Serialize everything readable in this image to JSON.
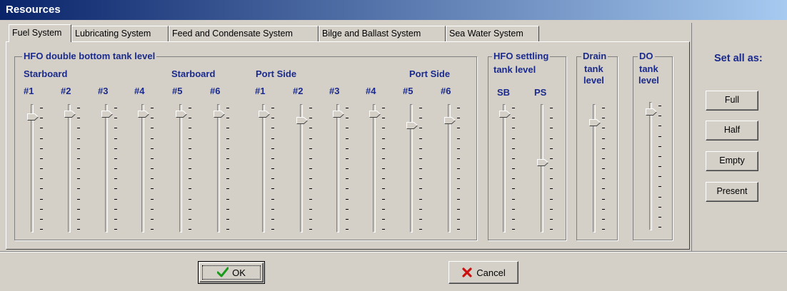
{
  "window": {
    "title": "Resources"
  },
  "tabs": [
    {
      "label": "Fuel System",
      "active": true
    },
    {
      "label": "Lubricating System",
      "active": false
    },
    {
      "label": "Feed and Condensate System",
      "active": false
    },
    {
      "label": "Bilge and Ballast System",
      "active": false
    },
    {
      "label": "Sea Water System",
      "active": false
    }
  ],
  "hfo_double_bottom": {
    "title": "HFO double bottom tank level",
    "side_labels": [
      "Starboard",
      "Starboard",
      "Port Side",
      "Port Side"
    ],
    "tanks": [
      {
        "label": "#1",
        "level": 0.93
      },
      {
        "label": "#2",
        "level": 0.95
      },
      {
        "label": "#3",
        "level": 0.95
      },
      {
        "label": "#4",
        "level": 0.95
      },
      {
        "label": "#5",
        "level": 0.95
      },
      {
        "label": "#6",
        "level": 0.95
      },
      {
        "label": "#1",
        "level": 0.95
      },
      {
        "label": "#2",
        "level": 0.9
      },
      {
        "label": "#3",
        "level": 0.95
      },
      {
        "label": "#4",
        "level": 0.95
      },
      {
        "label": "#5",
        "level": 0.86
      },
      {
        "label": "#6",
        "level": 0.9
      }
    ]
  },
  "hfo_settling": {
    "title_line1": "HFO settling",
    "title_line2": "tank level",
    "tanks": [
      {
        "label": "SB",
        "level": 0.95
      },
      {
        "label": "PS",
        "level": 0.55
      }
    ]
  },
  "drain": {
    "title_line1": "Drain",
    "title_line2": "tank",
    "title_line3": "level",
    "level": 0.88
  },
  "do": {
    "title_line1": "DO",
    "title_line2": "tank",
    "title_line3": "level",
    "level": 0.95
  },
  "set_all": {
    "label": "Set all as:",
    "buttons": [
      "Full",
      "Half",
      "Empty",
      "Present"
    ]
  },
  "buttons": {
    "ok": "OK",
    "cancel": "Cancel"
  },
  "colors": {
    "label_blue": "#1a2a8c",
    "face": "#d4d0c8",
    "title_start": "#0a246a"
  },
  "icons": {
    "ok": "check-icon",
    "cancel": "x-icon"
  }
}
